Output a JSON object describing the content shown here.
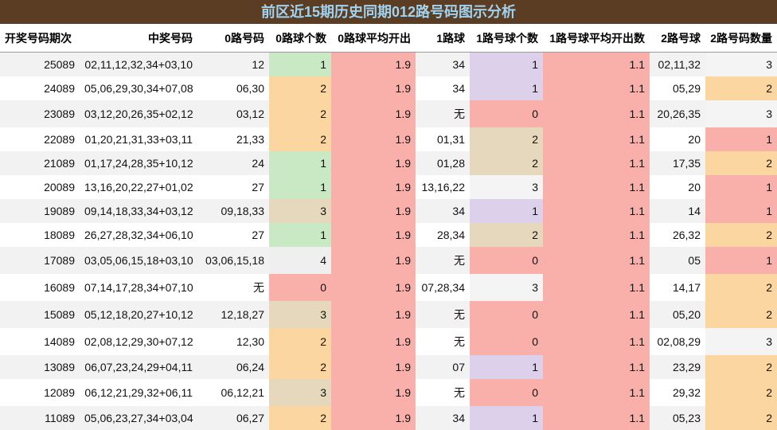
{
  "title": "前区近15期历史同期012路号码图示分析",
  "headers": [
    "开奖号码期次",
    "中奖号码",
    "0路号码",
    "0路球个数",
    "0路球平均开出",
    "1路球",
    "1路号球个数",
    "1路号球平均开出数",
    "2路号球",
    "2路号码数量"
  ],
  "rows": [
    [
      "25089",
      "02,11,12,32,34+03,10",
      "12",
      "1",
      "1.9",
      "34",
      "1",
      "1.1",
      "02,11,32",
      "3"
    ],
    [
      "24089",
      "05,06,29,30,34+07,08",
      "06,30",
      "2",
      "1.9",
      "34",
      "1",
      "1.1",
      "05,29",
      "2"
    ],
    [
      "23089",
      "03,12,20,26,35+02,12",
      "03,12",
      "2",
      "1.9",
      "无",
      "0",
      "1.1",
      "20,26,35",
      "3"
    ],
    [
      "22089",
      "01,20,21,31,33+03,11",
      "21,33",
      "2",
      "1.9",
      "01,31",
      "2",
      "1.1",
      "20",
      "1"
    ],
    [
      "21089",
      "01,17,24,28,35+10,12",
      "24",
      "1",
      "1.9",
      "01,28",
      "2",
      "1.1",
      "17,35",
      "2"
    ],
    [
      "20089",
      "13,16,20,22,27+01,02",
      "27",
      "1",
      "1.9",
      "13,16,22",
      "3",
      "1.1",
      "20",
      "1"
    ],
    [
      "19089",
      "09,14,18,33,34+03,12",
      "09,18,33",
      "3",
      "1.9",
      "34",
      "1",
      "1.1",
      "14",
      "1"
    ],
    [
      "18089",
      "26,27,28,32,34+06,10",
      "27",
      "1",
      "1.9",
      "28,34",
      "2",
      "1.1",
      "26,32",
      "2"
    ],
    [
      "17089",
      "03,05,06,15,18+03,10",
      "03,06,15,18",
      "4",
      "1.9",
      "无",
      "0",
      "1.1",
      "05",
      "1"
    ],
    [
      "16089",
      "07,14,17,28,34+07,10",
      "无",
      "0",
      "1.9",
      "07,28,34",
      "3",
      "1.1",
      "14,17",
      "2"
    ],
    [
      "15089",
      "05,12,18,20,27+10,12",
      "12,18,27",
      "3",
      "1.9",
      "无",
      "0",
      "1.1",
      "05,20",
      "2"
    ],
    [
      "14089",
      "02,08,12,29,30+07,12",
      "12,30",
      "2",
      "1.9",
      "无",
      "0",
      "1.1",
      "02,08,29",
      "3"
    ],
    [
      "13089",
      "06,07,23,24,29+04,11",
      "06,24",
      "2",
      "1.9",
      "07",
      "1",
      "1.1",
      "23,29",
      "2"
    ],
    [
      "12089",
      "06,12,21,29,32+06,11",
      "06,12,21",
      "3",
      "1.9",
      "无",
      "0",
      "1.1",
      "29,32",
      "2"
    ],
    [
      "11089",
      "05,06,23,27,34+03,04",
      "06,27",
      "2",
      "1.9",
      "34",
      "1",
      "1.1",
      "05,23",
      "2"
    ]
  ],
  "colors": {
    "title_bg": "#5a3d22",
    "title_text": "#9fd3f0",
    "count_1": "#c9e8c4",
    "count_2": "#fcd6a0",
    "count_3": "#e6d8bc",
    "count_4": "#efefef",
    "count_0": "#f9b0aa",
    "avg": "#f9b0aa",
    "ball1_count_1": "#ddd0ea"
  }
}
